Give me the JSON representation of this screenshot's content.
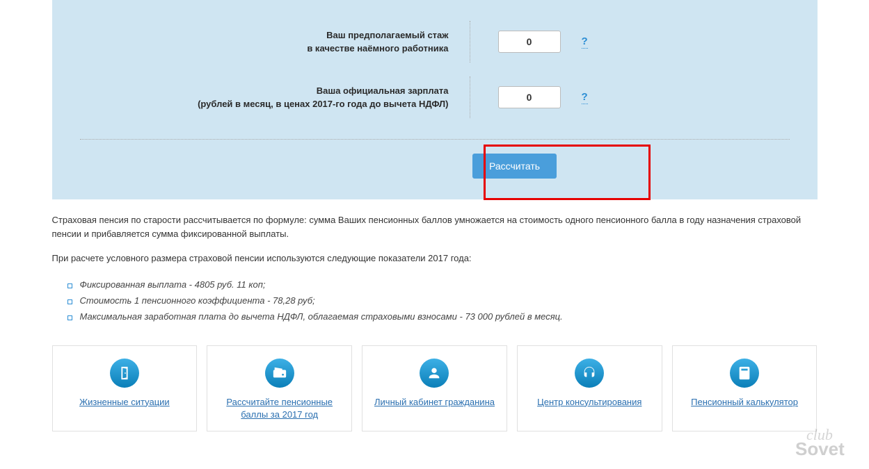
{
  "calculator": {
    "field1": {
      "label_line1": "Ваш предполагаемый стаж",
      "label_line2": "в качестве наёмного работника",
      "value": "0"
    },
    "field2": {
      "label_line1": "Ваша официальная зарплата",
      "label_line2": "(рублей в месяц, в ценах 2017-го года до вычета НДФЛ)",
      "value": "0"
    },
    "help_symbol": "?",
    "submit_label": "Рассчитать"
  },
  "info": {
    "paragraph1": "Страховая пенсия по старости рассчитывается по формуле: сумма Ваших пенсионных баллов умножается на стоимость одного пенсионного балла в году назначения страховой пенсии и прибавляется сумма фиксированной выплаты.",
    "paragraph2": "При расчете условного размера страховой пенсии используются следующие показатели 2017 года:",
    "bullets": [
      "Фиксированная выплата - 4805 руб. 11 коп;",
      "Стоимость 1 пенсионного коэффициента - 78,28 руб;",
      "Максимальная заработная плата до вычета НДФЛ, облагаемая страховыми взносами - 73 000 рублей в месяц."
    ]
  },
  "services": [
    {
      "label": "Жизненные ситуации",
      "icon": "door"
    },
    {
      "label": "Рассчитайте пенсионные баллы за 2017 год",
      "icon": "wallet"
    },
    {
      "label": "Личный кабинет гражданина",
      "icon": "user"
    },
    {
      "label": "Центр консультирования",
      "icon": "headset"
    },
    {
      "label": "Пенсионный калькулятор",
      "icon": "calculator"
    }
  ],
  "watermark": "Sovet club"
}
